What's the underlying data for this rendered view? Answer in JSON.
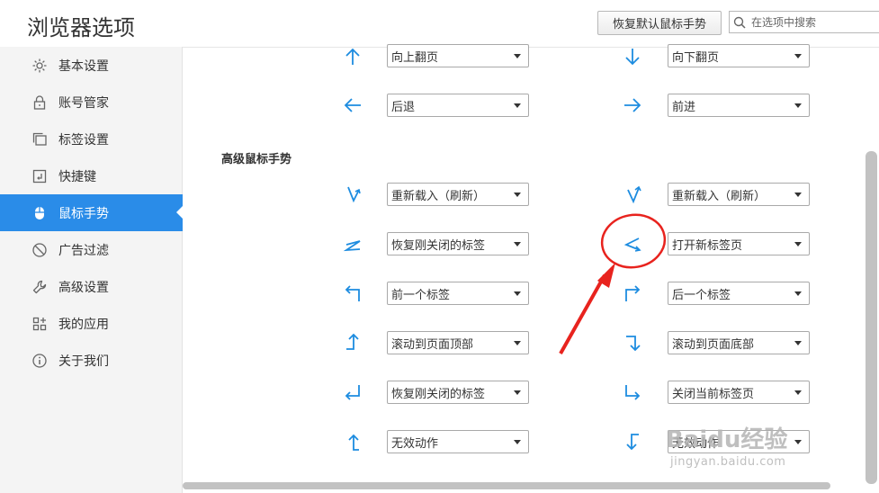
{
  "header": {
    "title": "浏览器选项",
    "restore_button": "恢复默认鼠标手势",
    "search_placeholder": "在选项中搜索"
  },
  "sidebar": {
    "items": [
      {
        "label": "基本设置",
        "icon": "gear-icon"
      },
      {
        "label": "账号管家",
        "icon": "lock-icon"
      },
      {
        "label": "标签设置",
        "icon": "tabs-icon"
      },
      {
        "label": "快捷键",
        "icon": "keyboard-key-icon"
      },
      {
        "label": "鼠标手势",
        "icon": "mouse-icon",
        "active": true
      },
      {
        "label": "广告过滤",
        "icon": "block-icon"
      },
      {
        "label": "高级设置",
        "icon": "wrench-icon"
      },
      {
        "label": "我的应用",
        "icon": "apps-grid-icon"
      },
      {
        "label": "关于我们",
        "icon": "info-icon"
      }
    ]
  },
  "basic_gestures": [
    {
      "icon": "arrow-up-icon",
      "value": "向上翻页"
    },
    {
      "icon": "arrow-down-icon",
      "value": "向下翻页"
    },
    {
      "icon": "arrow-left-icon",
      "value": "后退"
    },
    {
      "icon": "arrow-right-icon",
      "value": "前进"
    }
  ],
  "advanced_section_title": "高级鼠标手势",
  "advanced_gestures": [
    {
      "icon": "gesture-down-up-icon",
      "value": "重新载入（刷新）"
    },
    {
      "icon": "gesture-up-down-icon",
      "value": "重新载入（刷新）"
    },
    {
      "icon": "gesture-right-left-icon",
      "value": "恢复刚关闭的标签"
    },
    {
      "icon": "gesture-left-right-icon",
      "value": "打开新标签页"
    },
    {
      "icon": "gesture-up-left-icon",
      "value": "前一个标签"
    },
    {
      "icon": "gesture-up-right-icon",
      "value": "后一个标签"
    },
    {
      "icon": "gesture-left-up-icon",
      "value": "滚动到页面顶部"
    },
    {
      "icon": "gesture-right-down-icon",
      "value": "滚动到页面底部"
    },
    {
      "icon": "gesture-down-left-icon",
      "value": "恢复刚关闭的标签"
    },
    {
      "icon": "gesture-down-right-icon",
      "value": "关闭当前标签页"
    },
    {
      "icon": "gesture-right-up-icon",
      "value": "无效动作"
    },
    {
      "icon": "gesture-left-down-icon",
      "value": "无效动作"
    }
  ],
  "watermark": {
    "text": "Baidu经验",
    "sub": "jingyan.baidu.com"
  },
  "colors": {
    "accent": "#2a8ce8",
    "gesture_icon": "#1d8ce0",
    "annotation": "#e8231e"
  }
}
